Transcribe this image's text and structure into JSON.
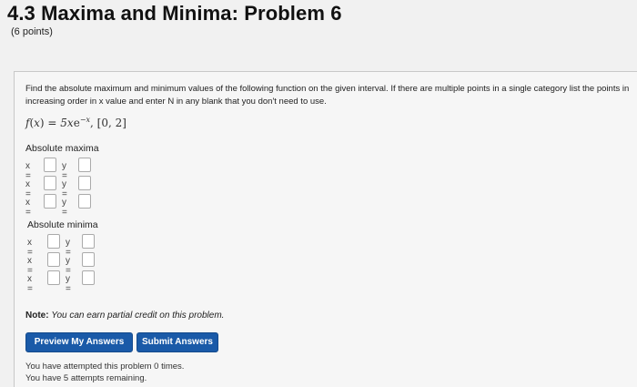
{
  "header": {
    "title": "4.3 Maxima and Minima: Problem 6",
    "points": "(6 points)"
  },
  "problem": {
    "instructions": "Find the absolute maximum and minimum values of the following function on the given interval. If there are multiple points in a single category list the points in increasing order in x value and enter N in any blank that you don't need to use.",
    "function_prefix": "f",
    "function_var": "x",
    "function_rhs": "5x",
    "function_exp": "−x",
    "interval": "[0, 2]"
  },
  "maxima": {
    "label": "Absolute maxima",
    "rows": [
      {
        "x_label": "x =",
        "x_value": "",
        "y_label": "y =",
        "y_value": ""
      },
      {
        "x_label": "x =",
        "x_value": "",
        "y_label": "y =",
        "y_value": ""
      },
      {
        "x_label": "x =",
        "x_value": "",
        "y_label": "y =",
        "y_value": ""
      }
    ]
  },
  "minima": {
    "label": "Absolute minima",
    "rows": [
      {
        "x_label": "x =",
        "x_value": "",
        "y_label": "y =",
        "y_value": ""
      },
      {
        "x_label": "x =",
        "x_value": "",
        "y_label": "y =",
        "y_value": ""
      },
      {
        "x_label": "x =",
        "x_value": "",
        "y_label": "y =",
        "y_value": ""
      }
    ]
  },
  "note": {
    "bold": "Note:",
    "text": "You can earn partial credit on this problem."
  },
  "buttons": {
    "preview": "Preview My Answers",
    "submit": "Submit Answers"
  },
  "status": {
    "attempted": "You have attempted this problem 0 times.",
    "remaining": "You have 5 attempts remaining."
  }
}
